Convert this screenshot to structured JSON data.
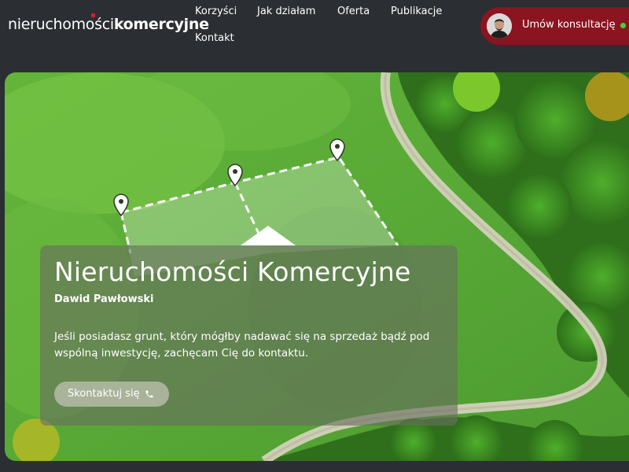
{
  "header": {
    "logo": {
      "light": "nieruchomości",
      "bold": "komercyjne"
    },
    "nav": [
      {
        "label": "Korzyści"
      },
      {
        "label": "Jak działam"
      },
      {
        "label": "Oferta"
      },
      {
        "label": "Publikacje"
      },
      {
        "label": "Kontakt"
      }
    ],
    "cta": {
      "label": "Umów konsultację",
      "status_color": "#3fd13f"
    }
  },
  "hero": {
    "title": "Nieruchomości Komercyjne",
    "author": "Dawid Pawłowski",
    "description": "Jeśli posiadasz grunt, który mógłby nadawać się na sprzedaż bądź pod wspólną inwestycję, zachęcam Cię do kontaktu.",
    "contact_button": {
      "label": "Skontaktuj się",
      "icon": "phone-icon"
    }
  },
  "colors": {
    "background": "#2b2e32",
    "cta_background": "#8a1420",
    "logo_accent": "#d6202c"
  }
}
